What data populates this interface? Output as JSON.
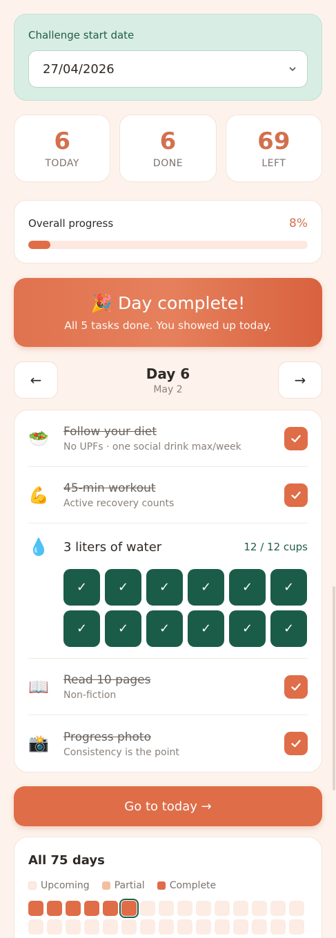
{
  "start": {
    "label": "Challenge start date",
    "value": "27/04/2026"
  },
  "stats": [
    {
      "value": "6",
      "label": "TODAY"
    },
    {
      "value": "6",
      "label": "DONE"
    },
    {
      "value": "69",
      "label": "LEFT"
    }
  ],
  "progress": {
    "label": "Overall progress",
    "percent_text": "8%",
    "fraction": 0.08
  },
  "banner": {
    "title": "🎉 Day complete!",
    "subtitle": "All 5 tasks done. You showed up today."
  },
  "daynav": {
    "prev": "←",
    "next": "→",
    "title": "Day 6",
    "date": "May 2"
  },
  "tasks": [
    {
      "icon": "🥗",
      "icon_name": "salad-icon",
      "title": "Follow your diet",
      "subtitle": "No UPFs · one social drink max/week",
      "checked": true
    },
    {
      "icon": "💪",
      "icon_name": "flexed-bicep-icon",
      "title": "45-min workout",
      "subtitle": "Active recovery counts",
      "checked": true
    },
    {
      "icon": "📖",
      "icon_name": "open-book-icon",
      "title": "Read 10 pages",
      "subtitle": "Non-fiction",
      "checked": true
    },
    {
      "icon": "📸",
      "icon_name": "camera-icon",
      "title": "Progress photo",
      "subtitle": "Consistency is the point",
      "checked": true
    }
  ],
  "water": {
    "icon": "💧",
    "icon_name": "water-drop-icon",
    "title": "3 liters of water",
    "count_text": "12 / 12 cups",
    "cups_filled": 12,
    "cups_total": 12,
    "cup_mark": "✓"
  },
  "go_button": "Go to today →",
  "all_days": {
    "title": "All 75 days",
    "legend": [
      "Upcoming",
      "Partial",
      "Complete"
    ],
    "colors": {
      "upcoming": "#fcece4",
      "partial": "#f3bf9f",
      "complete": "#df6d48",
      "today_outline": "#1b5c49"
    },
    "complete_days": 6,
    "today_index": 6
  },
  "colors": {
    "accent": "#df6d48",
    "green": "#1b5c49",
    "mint": "#d8ede3",
    "background": "#fdf3ec"
  }
}
